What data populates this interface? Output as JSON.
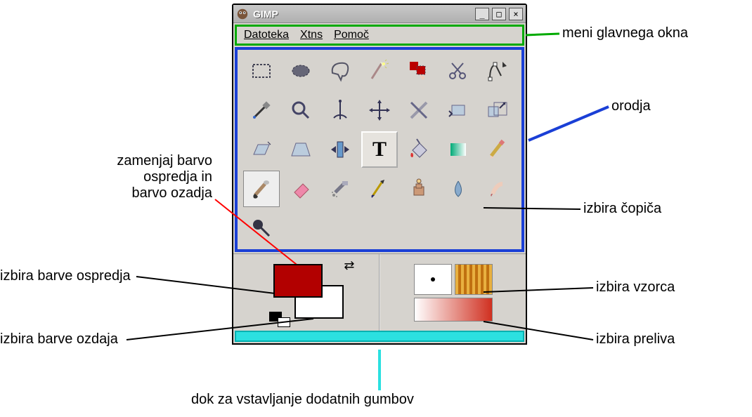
{
  "window": {
    "title": "GIMP",
    "menus": [
      "Datoteka",
      "Xtns",
      "Pomoč"
    ]
  },
  "tools": [
    {
      "name": "rect-select-tool"
    },
    {
      "name": "ellipse-select-tool"
    },
    {
      "name": "free-select-tool"
    },
    {
      "name": "fuzzy-select-tool"
    },
    {
      "name": "select-by-color-tool"
    },
    {
      "name": "scissors-tool"
    },
    {
      "name": "paths-tool"
    },
    {
      "name": "color-picker-tool"
    },
    {
      "name": "magnify-tool"
    },
    {
      "name": "measure-tool"
    },
    {
      "name": "move-tool"
    },
    {
      "name": "crop-tool"
    },
    {
      "name": "rotate-tool"
    },
    {
      "name": "scale-tool"
    },
    {
      "name": "shear-tool"
    },
    {
      "name": "perspective-tool"
    },
    {
      "name": "flip-tool"
    },
    {
      "name": "text-tool"
    },
    {
      "name": "bucket-fill-tool"
    },
    {
      "name": "blend-tool"
    },
    {
      "name": "pencil-tool"
    },
    {
      "name": "paintbrush-tool"
    },
    {
      "name": "eraser-tool"
    },
    {
      "name": "airbrush-tool"
    },
    {
      "name": "ink-tool"
    },
    {
      "name": "clone-tool"
    },
    {
      "name": "blur-tool"
    },
    {
      "name": "smudge-tool"
    },
    {
      "name": "dodge-burn-tool"
    }
  ],
  "colors": {
    "foreground": "#b20000",
    "background": "#ffffff"
  },
  "labels": {
    "menu": "meni glavnega okna",
    "tools": "orodja",
    "swap": "zamenjaj barvo\nospredja in\nbarvo ozadja",
    "fg": "izbira barve ospredja",
    "bg": "izbira barve ozdaja",
    "brush": "izbira čopiča",
    "pattern": "izbira vzorca",
    "gradient": "izbira preliva",
    "dock": "dok za vstavljanje dodatnih gumbov"
  },
  "annotation_colors": {
    "menu_box": "#00aa00",
    "tools_box": "#1a3fd6",
    "swap_line": "#ff0000",
    "dock_line": "#2be0e0"
  }
}
